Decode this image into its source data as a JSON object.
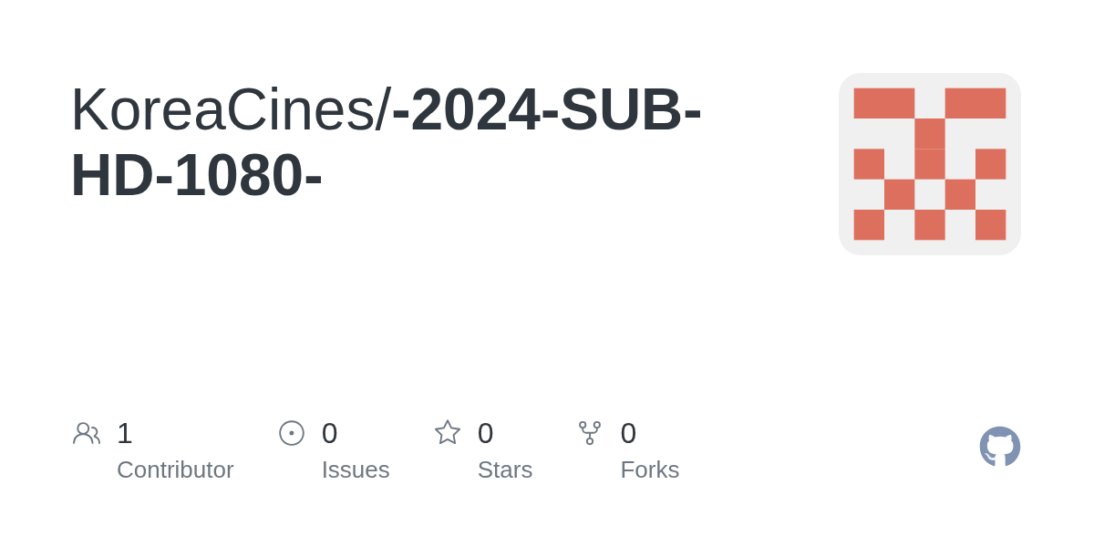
{
  "title": "KoreaCines/**-2024-SUB-HD-1080-**",
  "stats": [
    {
      "kind": "contributors",
      "value": "1",
      "label": "Contributor"
    },
    {
      "kind": "issues",
      "value": "0",
      "label": "Issues"
    },
    {
      "kind": "stars",
      "value": "0",
      "label": "Stars"
    },
    {
      "kind": "forks",
      "value": "0",
      "label": "Forks"
    }
  ]
}
